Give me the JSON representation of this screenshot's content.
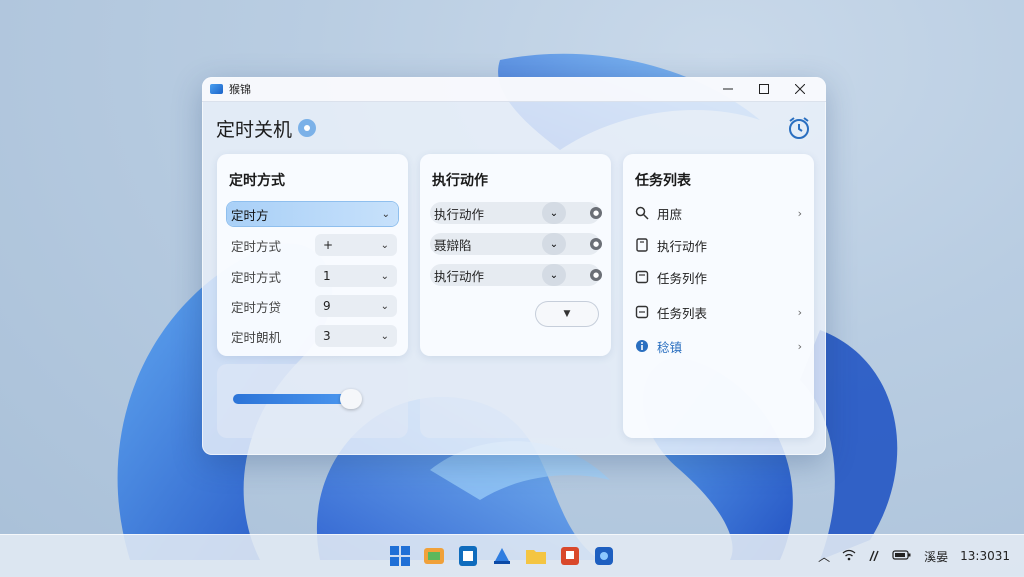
{
  "window": {
    "title": "猴锦"
  },
  "header": {
    "title": "定时关机"
  },
  "panel_mode": {
    "title": "定时方式",
    "rows": [
      {
        "label": "定时方",
        "value": "",
        "selected": true
      },
      {
        "label": "定时方式",
        "value": "+"
      },
      {
        "label": "定时方式",
        "value": "1"
      },
      {
        "label": "定时方贷",
        "value": "9"
      },
      {
        "label": "定时朗机",
        "value": "3"
      }
    ]
  },
  "panel_action": {
    "title": "执行动作",
    "rows": [
      {
        "label": "执行动作"
      },
      {
        "label": "聂辯陷"
      },
      {
        "label": "执行动作"
      }
    ]
  },
  "panel_tasks": {
    "title": "任务列表",
    "items": [
      {
        "label": "用庶",
        "icon": "search-icon",
        "arrow": "›"
      },
      {
        "label": "执行动作",
        "icon": "document-icon",
        "arrow": ""
      },
      {
        "label": "任务列作",
        "icon": "list-icon",
        "arrow": ""
      },
      {
        "label": "任务列表",
        "icon": "list-icon",
        "arrow": "›"
      },
      {
        "label": "稔镇",
        "icon": "info-icon",
        "arrow": "›",
        "accent": true
      }
    ]
  },
  "slider": {
    "value_fraction": 0.82
  },
  "tray": {
    "lang": "溪晏",
    "time": "13:3031"
  },
  "colors": {
    "accent": "#2a6fc0",
    "slider": "#2c74d8",
    "highlight": "#a9d0f7"
  }
}
